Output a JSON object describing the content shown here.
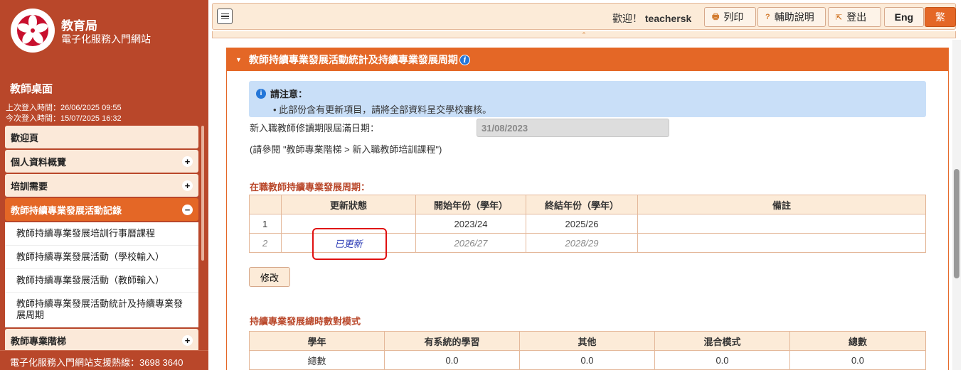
{
  "sidebar": {
    "org_title": "教育局",
    "portal_title": "電子化服務入門網站",
    "desk_title": "教師桌面",
    "last_login": "上次登入時間：26/06/2025 09:55",
    "this_login": "今次登入時間：15/07/2025 16:32",
    "menu": [
      {
        "label": "歡迎頁",
        "sign": ""
      },
      {
        "label": "個人資料概覽",
        "sign": "+"
      },
      {
        "label": "培訓需要",
        "sign": "+"
      },
      {
        "label": "教師持續專業發展活動記錄",
        "sign": "−"
      }
    ],
    "submenu": [
      "教師持續專業發展培訓行事曆課程",
      "教師持續專業發展活動（學校輸入）",
      "教師持續專業發展活動（教師輸入）",
      "教師持續專業發展活動統計及持續專業發展周期"
    ],
    "menu_after": {
      "label": "教師專業階梯",
      "sign": "+"
    },
    "hotline": "電子化服務入門網站支援熱線：3698 3640"
  },
  "topbar": {
    "welcome_prefix": "歡迎！",
    "username": "teachersk",
    "print_label": "列印",
    "help_label": "輔助說明",
    "logout_label": "登出",
    "eng_label": "Eng",
    "trad_label": "繁"
  },
  "panel": {
    "title": "教師持續專業發展活動統計及持續專業發展周期",
    "notice_title": "請注意：",
    "notice_item": "此部份含有更新項目，請將全部資料呈交學校審核。",
    "deadline_label": "新入職教師修讀期限屆滿日期：",
    "deadline_value": "31/08/2023",
    "ref_note": "(請參閱 \"教師專業階梯 > 新入職教師培訓課程\")",
    "cycle_title": "在職教師持續專業發展周期：",
    "cycle_headers": [
      "",
      "更新狀態",
      "開始年份（學年）",
      "終結年份（學年）",
      "備註"
    ],
    "cycle_rows": [
      {
        "idx": "1",
        "status": "",
        "start": "2023/24",
        "end": "2025/26",
        "remark": ""
      },
      {
        "idx": "2",
        "status": "已更新",
        "start": "2026/27",
        "end": "2028/29",
        "remark": ""
      }
    ],
    "edit_label": "修改",
    "hours_title": "持續專業發展總時數對模式",
    "hours_headers": [
      "學年",
      "有系統的學習",
      "其他",
      "混合模式",
      "總數"
    ],
    "hours_rows": [
      [
        "總數",
        "0.0",
        "0.0",
        "0.0",
        "0.0"
      ]
    ]
  },
  "colors": {
    "sidebar_bg": "#b9472a",
    "accent": "#e46726",
    "notice_bg": "#c9dff8",
    "highlight": "#e01010"
  }
}
